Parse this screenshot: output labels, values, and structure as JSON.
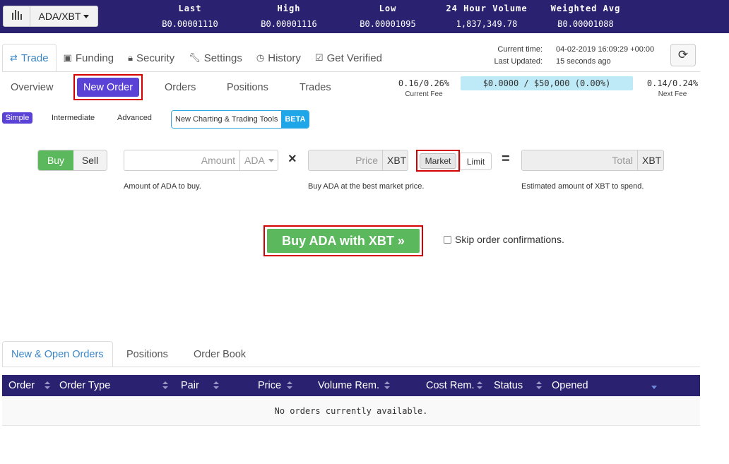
{
  "ticker": {
    "pair": "ADA/XBT",
    "stats": [
      {
        "title": "Last",
        "value": "Ƀ0.00001110"
      },
      {
        "title": "High",
        "value": "Ƀ0.00001116"
      },
      {
        "title": "Low",
        "value": "Ƀ0.00001095"
      },
      {
        "title": "24 Hour Volume",
        "value": "1,837,349.78"
      },
      {
        "title": "Weighted Avg",
        "value": "Ƀ0.00001088"
      }
    ]
  },
  "nav": {
    "items": [
      {
        "label": "Trade",
        "icon": "exchange-icon"
      },
      {
        "label": "Funding",
        "icon": "money-icon"
      },
      {
        "label": "Security",
        "icon": "lock-icon"
      },
      {
        "label": "Settings",
        "icon": "wrench-icon"
      },
      {
        "label": "History",
        "icon": "clock-icon"
      },
      {
        "label": "Get Verified",
        "icon": "check-square-icon"
      }
    ],
    "active": "Trade"
  },
  "time": {
    "current_label": "Current time:",
    "current_value": "04-02-2019 16:09:29 +00:00",
    "updated_label": "Last Updated:",
    "updated_value": "15 seconds ago"
  },
  "subnav": {
    "items": [
      "Overview",
      "New Order",
      "Orders",
      "Positions",
      "Trades"
    ],
    "active": "New Order"
  },
  "fees": {
    "current_value": "0.16/0.26%",
    "current_label": "Current Fee",
    "progress": "$0.0000 / $50,000 (0.00%)",
    "next_value": "0.14/0.24%",
    "next_label": "Next Fee"
  },
  "modes": {
    "simple": "Simple",
    "intermediate": "Intermediate",
    "advanced": "Advanced",
    "charting": "New Charting & Trading Tools",
    "beta": "BETA"
  },
  "form": {
    "buy": "Buy",
    "sell": "Sell",
    "amount_placeholder": "Amount",
    "amount_currency": "ADA",
    "amount_help": "Amount of ADA to buy.",
    "times": "×",
    "price_placeholder": "Price",
    "price_currency": "XBT",
    "price_help": "Buy ADA at the best market price.",
    "market": "Market",
    "limit": "Limit",
    "equals": "=",
    "total_placeholder": "Total",
    "total_currency": "XBT",
    "total_help": "Estimated amount of XBT to spend.",
    "submit": "Buy ADA with XBT »",
    "skip": "Skip order confirmations."
  },
  "bottom": {
    "tabs": [
      "New & Open Orders",
      "Positions",
      "Order Book"
    ],
    "columns": [
      "Order",
      "Order Type",
      "Pair",
      "Price",
      "Volume Rem.",
      "Cost Rem.",
      "Status",
      "Opened"
    ],
    "empty": "No orders currently available."
  },
  "colors": {
    "header_bg": "#2a2270",
    "accent_purple": "#5a42d6",
    "buy_green": "#5cb85c",
    "link_blue": "#3a86c8",
    "highlight_red": "#d40000"
  }
}
